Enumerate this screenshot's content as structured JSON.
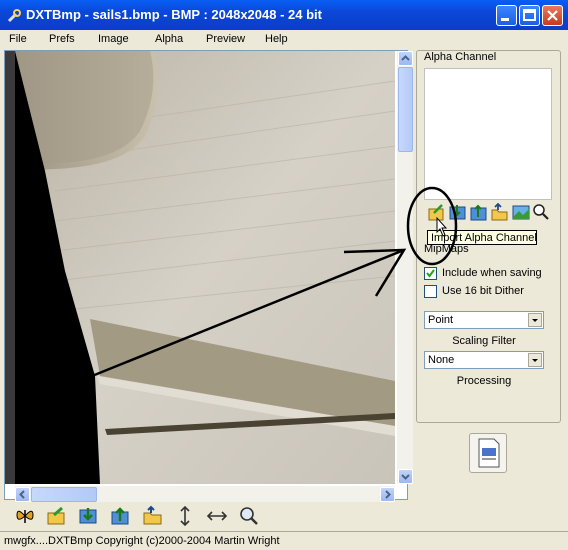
{
  "window": {
    "title": "DXTBmp - sails1.bmp - BMP : 2048x2048 - 24 bit",
    "icon": "wrench-icon"
  },
  "menu": {
    "items": [
      "File",
      "Prefs",
      "Image",
      "Alpha",
      "Preview",
      "Help"
    ]
  },
  "alpha_channel": {
    "group_label": "Alpha Channel",
    "icons": [
      "import-alpha-icon",
      "export-alpha-icon",
      "save-alpha-icon",
      "open-folder-icon",
      "view-alpha-icon",
      "magnify-icon"
    ],
    "tooltip": "Import Alpha Channel"
  },
  "mipmaps": {
    "group_label": "MipMaps",
    "include_when_saving": {
      "label": "Include when saving",
      "checked": true
    },
    "dither": {
      "label": "Use 16 bit Dither",
      "checked": false
    },
    "scaling_filter": {
      "value": "Point",
      "caption": "Scaling Filter"
    },
    "processing": {
      "value": "None",
      "caption": "Processing"
    }
  },
  "toolbar": {
    "icons": [
      "butterfly-icon",
      "open-icon",
      "export-icon",
      "save-icon",
      "folder-icon",
      "flip-vertical-icon",
      "flip-horizontal-icon",
      "zoom-icon"
    ]
  },
  "status": {
    "text": "mwgfx....DXTBmp Copyright (c)2000-2004 Martin Wright"
  },
  "colors": {
    "title_bar": "#0b47d8",
    "window_bg": "#ece9d8",
    "annotation": "#000000"
  }
}
